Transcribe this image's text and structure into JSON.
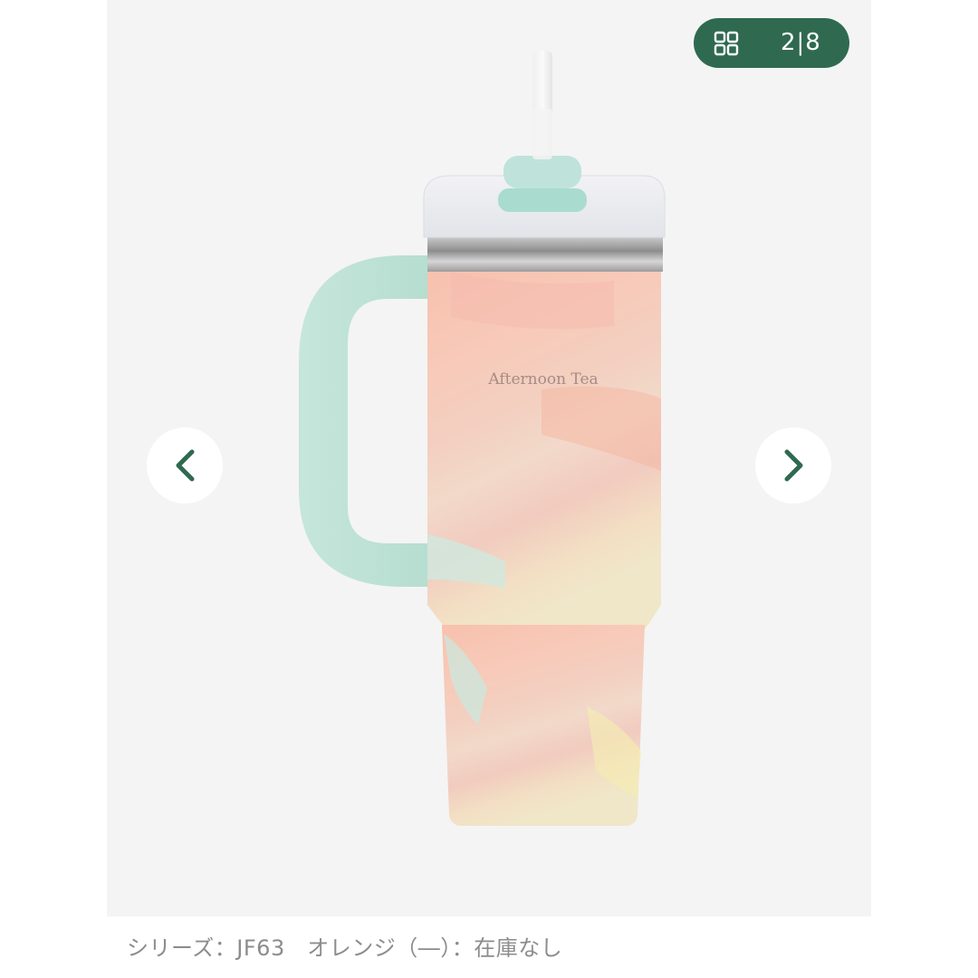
{
  "gallery": {
    "counter": {
      "icon": "grid-icon",
      "text": "2|8"
    },
    "prev_icon": "chevron-left-icon",
    "next_icon": "chevron-right-icon",
    "image": {
      "brand_text": "Afternoon Tea"
    }
  },
  "caption": {
    "text": "シリーズ：JF63　オレンジ（―）：在庫なし"
  },
  "colors": {
    "badge": "#2f6a50",
    "accent_arrow": "#2f6a50",
    "caption_text": "#8c8c8c",
    "image_bg": "#f4f4f4"
  }
}
